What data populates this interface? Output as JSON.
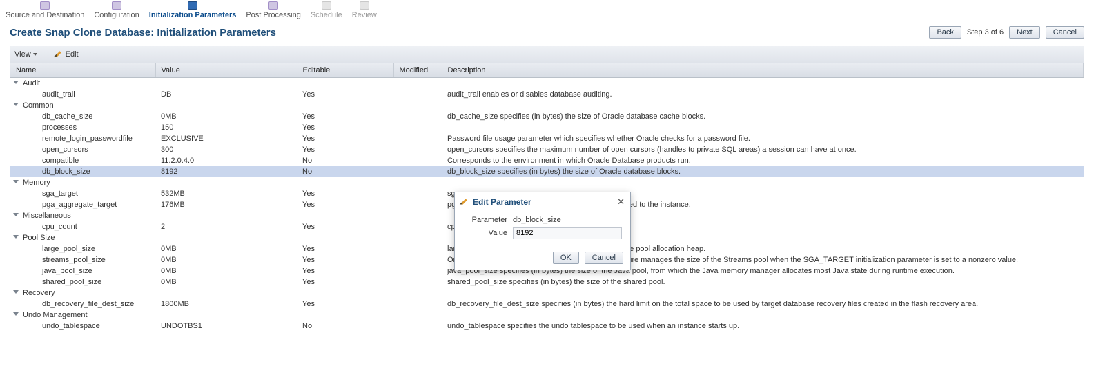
{
  "wizard": {
    "steps": [
      {
        "label": "Source and Destination",
        "state": "done"
      },
      {
        "label": "Configuration",
        "state": "done"
      },
      {
        "label": "Initialization Parameters",
        "state": "current"
      },
      {
        "label": "Post Processing",
        "state": "done"
      },
      {
        "label": "Schedule",
        "state": "future"
      },
      {
        "label": "Review",
        "state": "future"
      }
    ]
  },
  "page_title": "Create Snap Clone Database: Initialization Parameters",
  "header_buttons": {
    "back": "Back",
    "step_text": "Step 3 of 6",
    "next": "Next",
    "cancel": "Cancel"
  },
  "toolbar": {
    "view_label": "View",
    "edit_label": "Edit"
  },
  "columns": {
    "name": "Name",
    "value": "Value",
    "editable": "Editable",
    "modified": "Modified",
    "description": "Description"
  },
  "groups": [
    {
      "label": "Audit",
      "rows": [
        {
          "name": "audit_trail",
          "value": "DB",
          "editable": "Yes",
          "modified": "",
          "description": "audit_trail enables or disables database auditing."
        }
      ]
    },
    {
      "label": "Common",
      "rows": [
        {
          "name": "db_cache_size",
          "value": "0MB",
          "editable": "Yes",
          "modified": "",
          "description": "db_cache_size specifies (in bytes) the size of Oracle database cache blocks."
        },
        {
          "name": "processes",
          "value": "150",
          "editable": "Yes",
          "modified": "",
          "description": ""
        },
        {
          "name": "remote_login_passwordfile",
          "value": "EXCLUSIVE",
          "editable": "Yes",
          "modified": "",
          "description": "Password file usage parameter which specifies whether Oracle checks for a password file."
        },
        {
          "name": "open_cursors",
          "value": "300",
          "editable": "Yes",
          "modified": "",
          "description": "open_cursors specifies the maximum number of open cursors (handles to private SQL areas) a session can have at once."
        },
        {
          "name": "compatible",
          "value": "11.2.0.4.0",
          "editable": "No",
          "modified": "",
          "description": "Corresponds to the environment in which Oracle Database products run."
        },
        {
          "name": "db_block_size",
          "value": "8192",
          "editable": "No",
          "modified": "",
          "description": "db_block_size specifies (in bytes) the size of Oracle database blocks.",
          "selected": true
        }
      ]
    },
    {
      "label": "Memory",
      "rows": [
        {
          "name": "sga_target",
          "value": "532MB",
          "editable": "Yes",
          "modified": "",
          "description": "sga"
        },
        {
          "name": "pga_aggregate_target",
          "value": "176MB",
          "editable": "Yes",
          "modified": "",
          "description": "pga                                                                                      A memory available to all server processes attached to the instance."
        }
      ]
    },
    {
      "label": "Miscellaneous",
      "rows": [
        {
          "name": "cpu_count",
          "value": "2",
          "editable": "Yes",
          "modified": "",
          "description": "cpu                                                                                      e."
        }
      ]
    },
    {
      "label": "Pool Size",
      "rows": [
        {
          "name": "large_pool_size",
          "value": "0MB",
          "editable": "Yes",
          "modified": "",
          "description": "large_pool_size specifies (in bytes) the size of the large pool allocation heap."
        },
        {
          "name": "streams_pool_size",
          "value": "0MB",
          "editable": "Yes",
          "modified": "",
          "description": "Oracle's Automatic Shared Memory Management feature manages the size of the Streams pool when the SGA_TARGET initialization parameter is set to a nonzero value."
        },
        {
          "name": "java_pool_size",
          "value": "0MB",
          "editable": "Yes",
          "modified": "",
          "description": "java_pool_size specifies (in bytes) the size of the Java pool, from which the Java memory manager allocates most Java state during runtime execution."
        },
        {
          "name": "shared_pool_size",
          "value": "0MB",
          "editable": "Yes",
          "modified": "",
          "description": "shared_pool_size specifies (in bytes) the size of the shared pool."
        }
      ]
    },
    {
      "label": "Recovery",
      "rows": [
        {
          "name": "db_recovery_file_dest_size",
          "value": "1800MB",
          "editable": "Yes",
          "modified": "",
          "description": "db_recovery_file_dest_size specifies (in bytes) the hard limit on the total space to be used by target database recovery files created in the flash recovery area."
        }
      ]
    },
    {
      "label": "Undo Management",
      "rows": [
        {
          "name": "undo_tablespace",
          "value": "UNDOTBS1",
          "editable": "No",
          "modified": "",
          "description": "undo_tablespace specifies the undo tablespace to be used when an instance starts up."
        }
      ]
    }
  ],
  "dialog": {
    "title": "Edit Parameter",
    "param_label": "Parameter",
    "param_value": "db_block_size",
    "value_label": "Value",
    "value_input": "8192",
    "ok": "OK",
    "cancel": "Cancel"
  }
}
